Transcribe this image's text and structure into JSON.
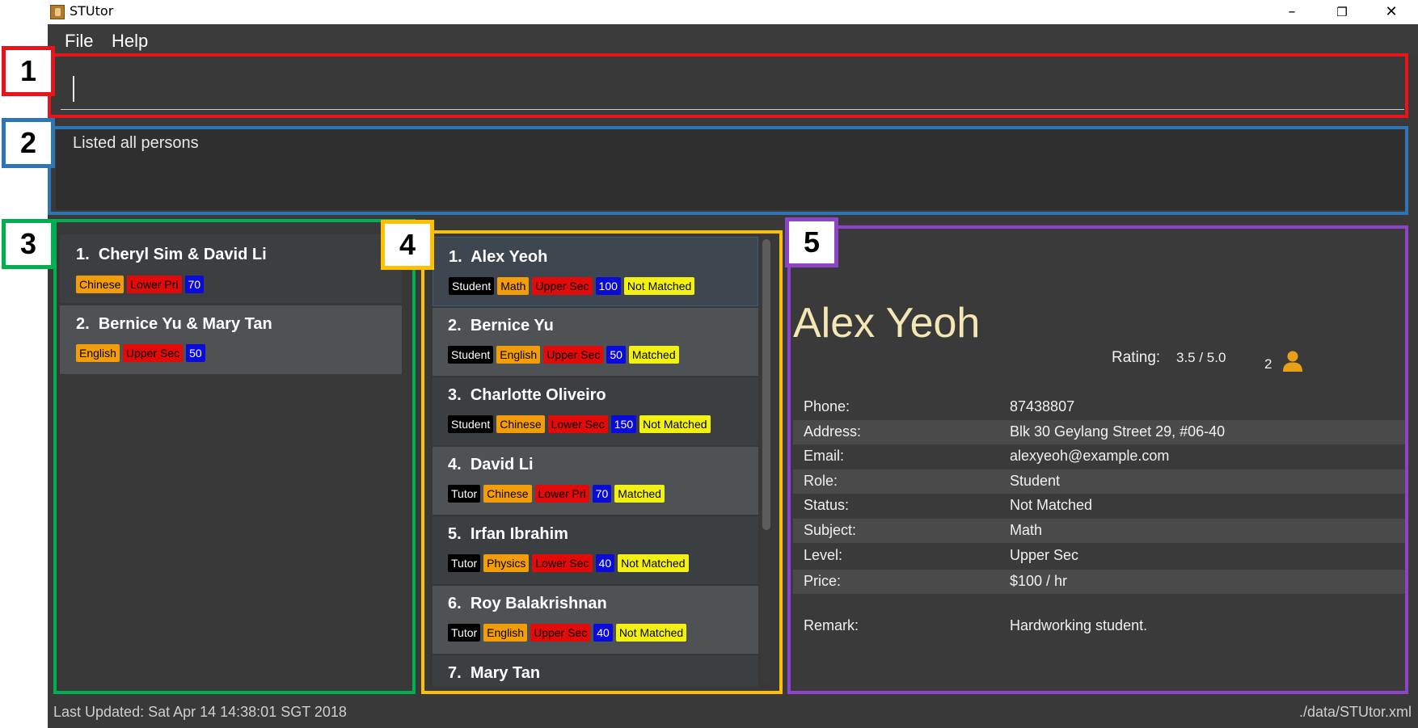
{
  "window": {
    "title": "STUtor",
    "minimize": "–",
    "restore": "❐",
    "close": "✕"
  },
  "menu": {
    "file": "File",
    "help": "Help"
  },
  "command": {
    "value": ""
  },
  "result": {
    "text": "Listed all persons"
  },
  "annotations": [
    "1",
    "2",
    "3",
    "4",
    "5"
  ],
  "match_list": [
    {
      "index": "1.",
      "name": "Cheryl Sim & David Li",
      "subject": "Chinese",
      "level": "Lower Pri",
      "price": "70"
    },
    {
      "index": "2.",
      "name": "Bernice Yu & Mary Tan",
      "subject": "English",
      "level": "Upper Sec",
      "price": "50"
    }
  ],
  "person_list": [
    {
      "index": "1.",
      "name": "Alex Yeoh",
      "role": "Student",
      "subject": "Math",
      "level": "Upper Sec",
      "price": "100",
      "status": "Not Matched"
    },
    {
      "index": "2.",
      "name": "Bernice Yu",
      "role": "Student",
      "subject": "English",
      "level": "Upper Sec",
      "price": "50",
      "status": "Matched"
    },
    {
      "index": "3.",
      "name": "Charlotte Oliveiro",
      "role": "Student",
      "subject": "Chinese",
      "level": "Lower Sec",
      "price": "150",
      "status": "Not Matched"
    },
    {
      "index": "4.",
      "name": "David Li",
      "role": "Tutor",
      "subject": "Chinese",
      "level": "Lower Pri",
      "price": "70",
      "status": "Matched"
    },
    {
      "index": "5.",
      "name": "Irfan Ibrahim",
      "role": "Tutor",
      "subject": "Physics",
      "level": "Lower Sec",
      "price": "40",
      "status": "Not Matched"
    },
    {
      "index": "6.",
      "name": "Roy Balakrishnan",
      "role": "Tutor",
      "subject": "English",
      "level": "Upper Sec",
      "price": "40",
      "status": "Not Matched"
    },
    {
      "index": "7.",
      "name": "Mary Tan"
    }
  ],
  "details": {
    "name": "Alex Yeoh",
    "rating_label": "Rating:",
    "rating_value": "3.5  / 5.0",
    "count": "2",
    "rows": [
      {
        "label": "Phone:",
        "value": "87438807"
      },
      {
        "label": "Address:",
        "value": "Blk 30 Geylang Street 29, #06-40"
      },
      {
        "label": "Email:",
        "value": "alexyeoh@example.com"
      },
      {
        "label": "Role:",
        "value": "Student"
      },
      {
        "label": "Status:",
        "value": "Not Matched"
      },
      {
        "label": "Subject:",
        "value": "Math"
      },
      {
        "label": "Level:",
        "value": "Upper Sec"
      },
      {
        "label": "Price:",
        "value": "$100 / hr"
      }
    ],
    "remark_label": "Remark:",
    "remark_value": "Hardworking student."
  },
  "status": {
    "last_updated": "Last Updated: Sat Apr 14 14:38:01 SGT 2018",
    "file_path": "./data/STUtor.xml"
  },
  "colors": {
    "frame_1": "#e8141c",
    "frame_2": "#2e75b6",
    "frame_3": "#00b050",
    "frame_4": "#ffc000",
    "frame_5": "#8e44c6",
    "tag_role": "#000000",
    "tag_subject": "#f39d0b",
    "tag_level": "#e30a0a",
    "tag_price": "#0b0bd9",
    "tag_status": "#f3f014",
    "person_icon": "#e8a019"
  },
  "icons": {
    "app": "app-icon",
    "person": "person-icon"
  }
}
